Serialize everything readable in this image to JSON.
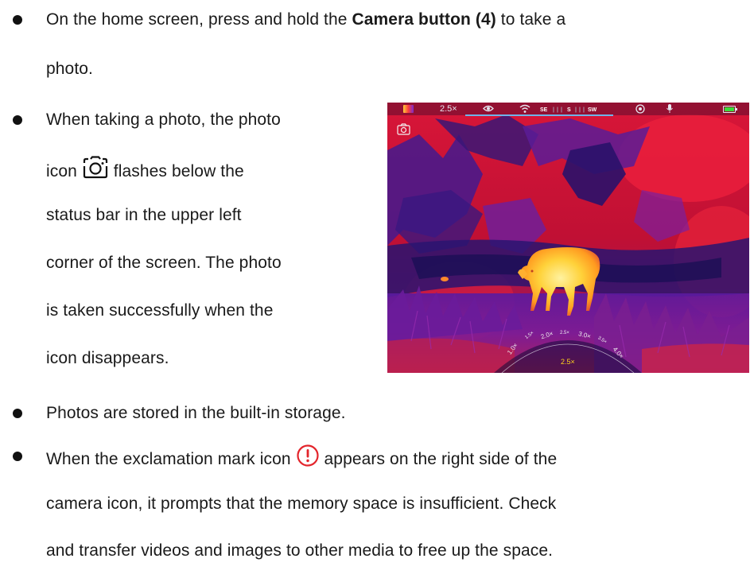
{
  "instructions": {
    "bullet1": {
      "line1_before": "On the home screen, press and hold the ",
      "line1_bold": "Camera button (4)",
      "line1_after": " to take a",
      "line2": "photo."
    },
    "bullet2": {
      "line1": "When taking a photo, the photo",
      "line2_before": "icon ",
      "line2_after": " flashes below the",
      "line3": "status bar in the upper left",
      "line4": "corner of the screen. The photo",
      "line5": "is taken successfully when the",
      "line6": "icon disappears."
    },
    "bullet3": {
      "line1": "Photos are stored in the built-in storage."
    },
    "bullet4": {
      "line1_before": "When the exclamation mark icon ",
      "line1_after": " appears on the right side of the",
      "line2": "camera icon, it prompts that the memory space is insufficient. Check",
      "line3": "and transfer videos and images to other media to free up the space."
    }
  },
  "thermal_screen": {
    "status_bar": {
      "zoom": "2.5×",
      "compass": {
        "left": "SE",
        "center": "S",
        "right": "SW"
      }
    },
    "zoom_scale": {
      "labels": [
        "1.0×",
        "1.5×",
        "2.0×",
        "2.5×",
        "3.0×",
        "3.5×",
        "4.0×"
      ],
      "current": "2.5×"
    },
    "icons": [
      "palette-icon",
      "eye-icon",
      "wifi-icon",
      "shutter-icon",
      "microphone-icon",
      "battery-icon",
      "camera-icon"
    ]
  },
  "colors": {
    "thermal_hot": "#ffd23a",
    "thermal_warm": "#e0203a",
    "thermal_cool": "#6a1fa0",
    "thermal_cold": "#1a1460",
    "compass_line": "#6fb3e8",
    "battery": "#3adb3a",
    "alert_icon": "#e3242b"
  }
}
